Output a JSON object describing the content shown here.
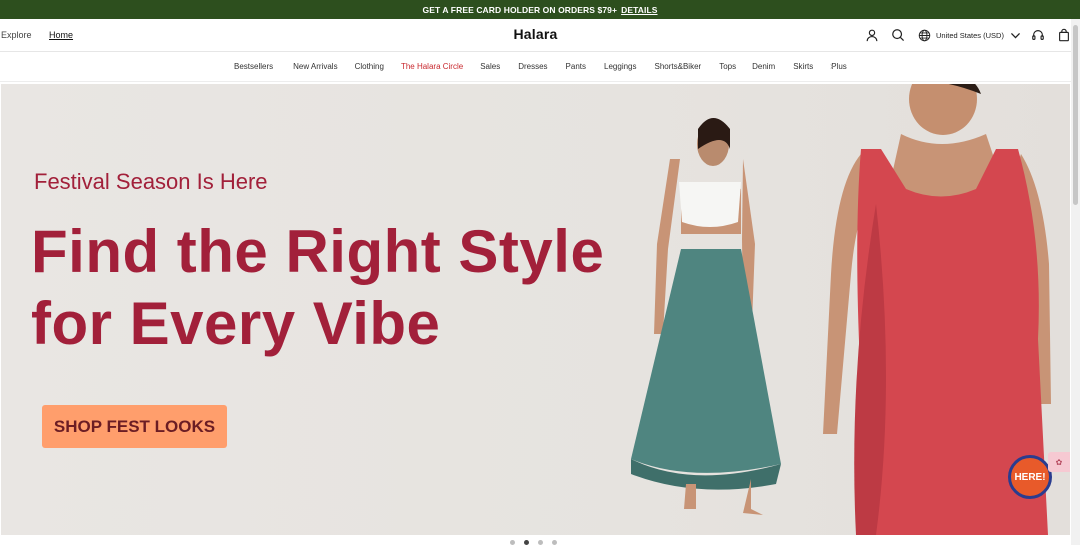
{
  "promo": {
    "text": "GET A FREE CARD HOLDER ON ORDERS $79+",
    "link": "DETAILS"
  },
  "header": {
    "explore": "Explore",
    "home": "Home",
    "logo": "Halara",
    "region": "United States (USD)",
    "icons": [
      "account-icon",
      "search-icon",
      "globe-icon",
      "chevron-down-icon",
      "headset-icon",
      "bag-icon"
    ]
  },
  "nav": {
    "items": [
      "Bestsellers",
      "New Arrivals",
      "Clothing",
      "The Halara Circle",
      "Sales",
      "Dresses",
      "Pants",
      "Leggings",
      "Shorts&Biker",
      "Tops",
      "Denim",
      "Skirts",
      "Plus"
    ],
    "active_index": 3,
    "active_color": "#c8282e"
  },
  "hero": {
    "eyebrow": "Festival Season Is Here",
    "headline_line1": "Find the Right Style",
    "headline_line2": "for Every Vibe",
    "cta": "SHOP FEST LOOKS",
    "text_color": "#a2203a",
    "cta_color": "#ff9e6c"
  },
  "badge": {
    "text": "HERE!"
  },
  "carousel": {
    "slide_count": 4,
    "active_slide": 2
  }
}
